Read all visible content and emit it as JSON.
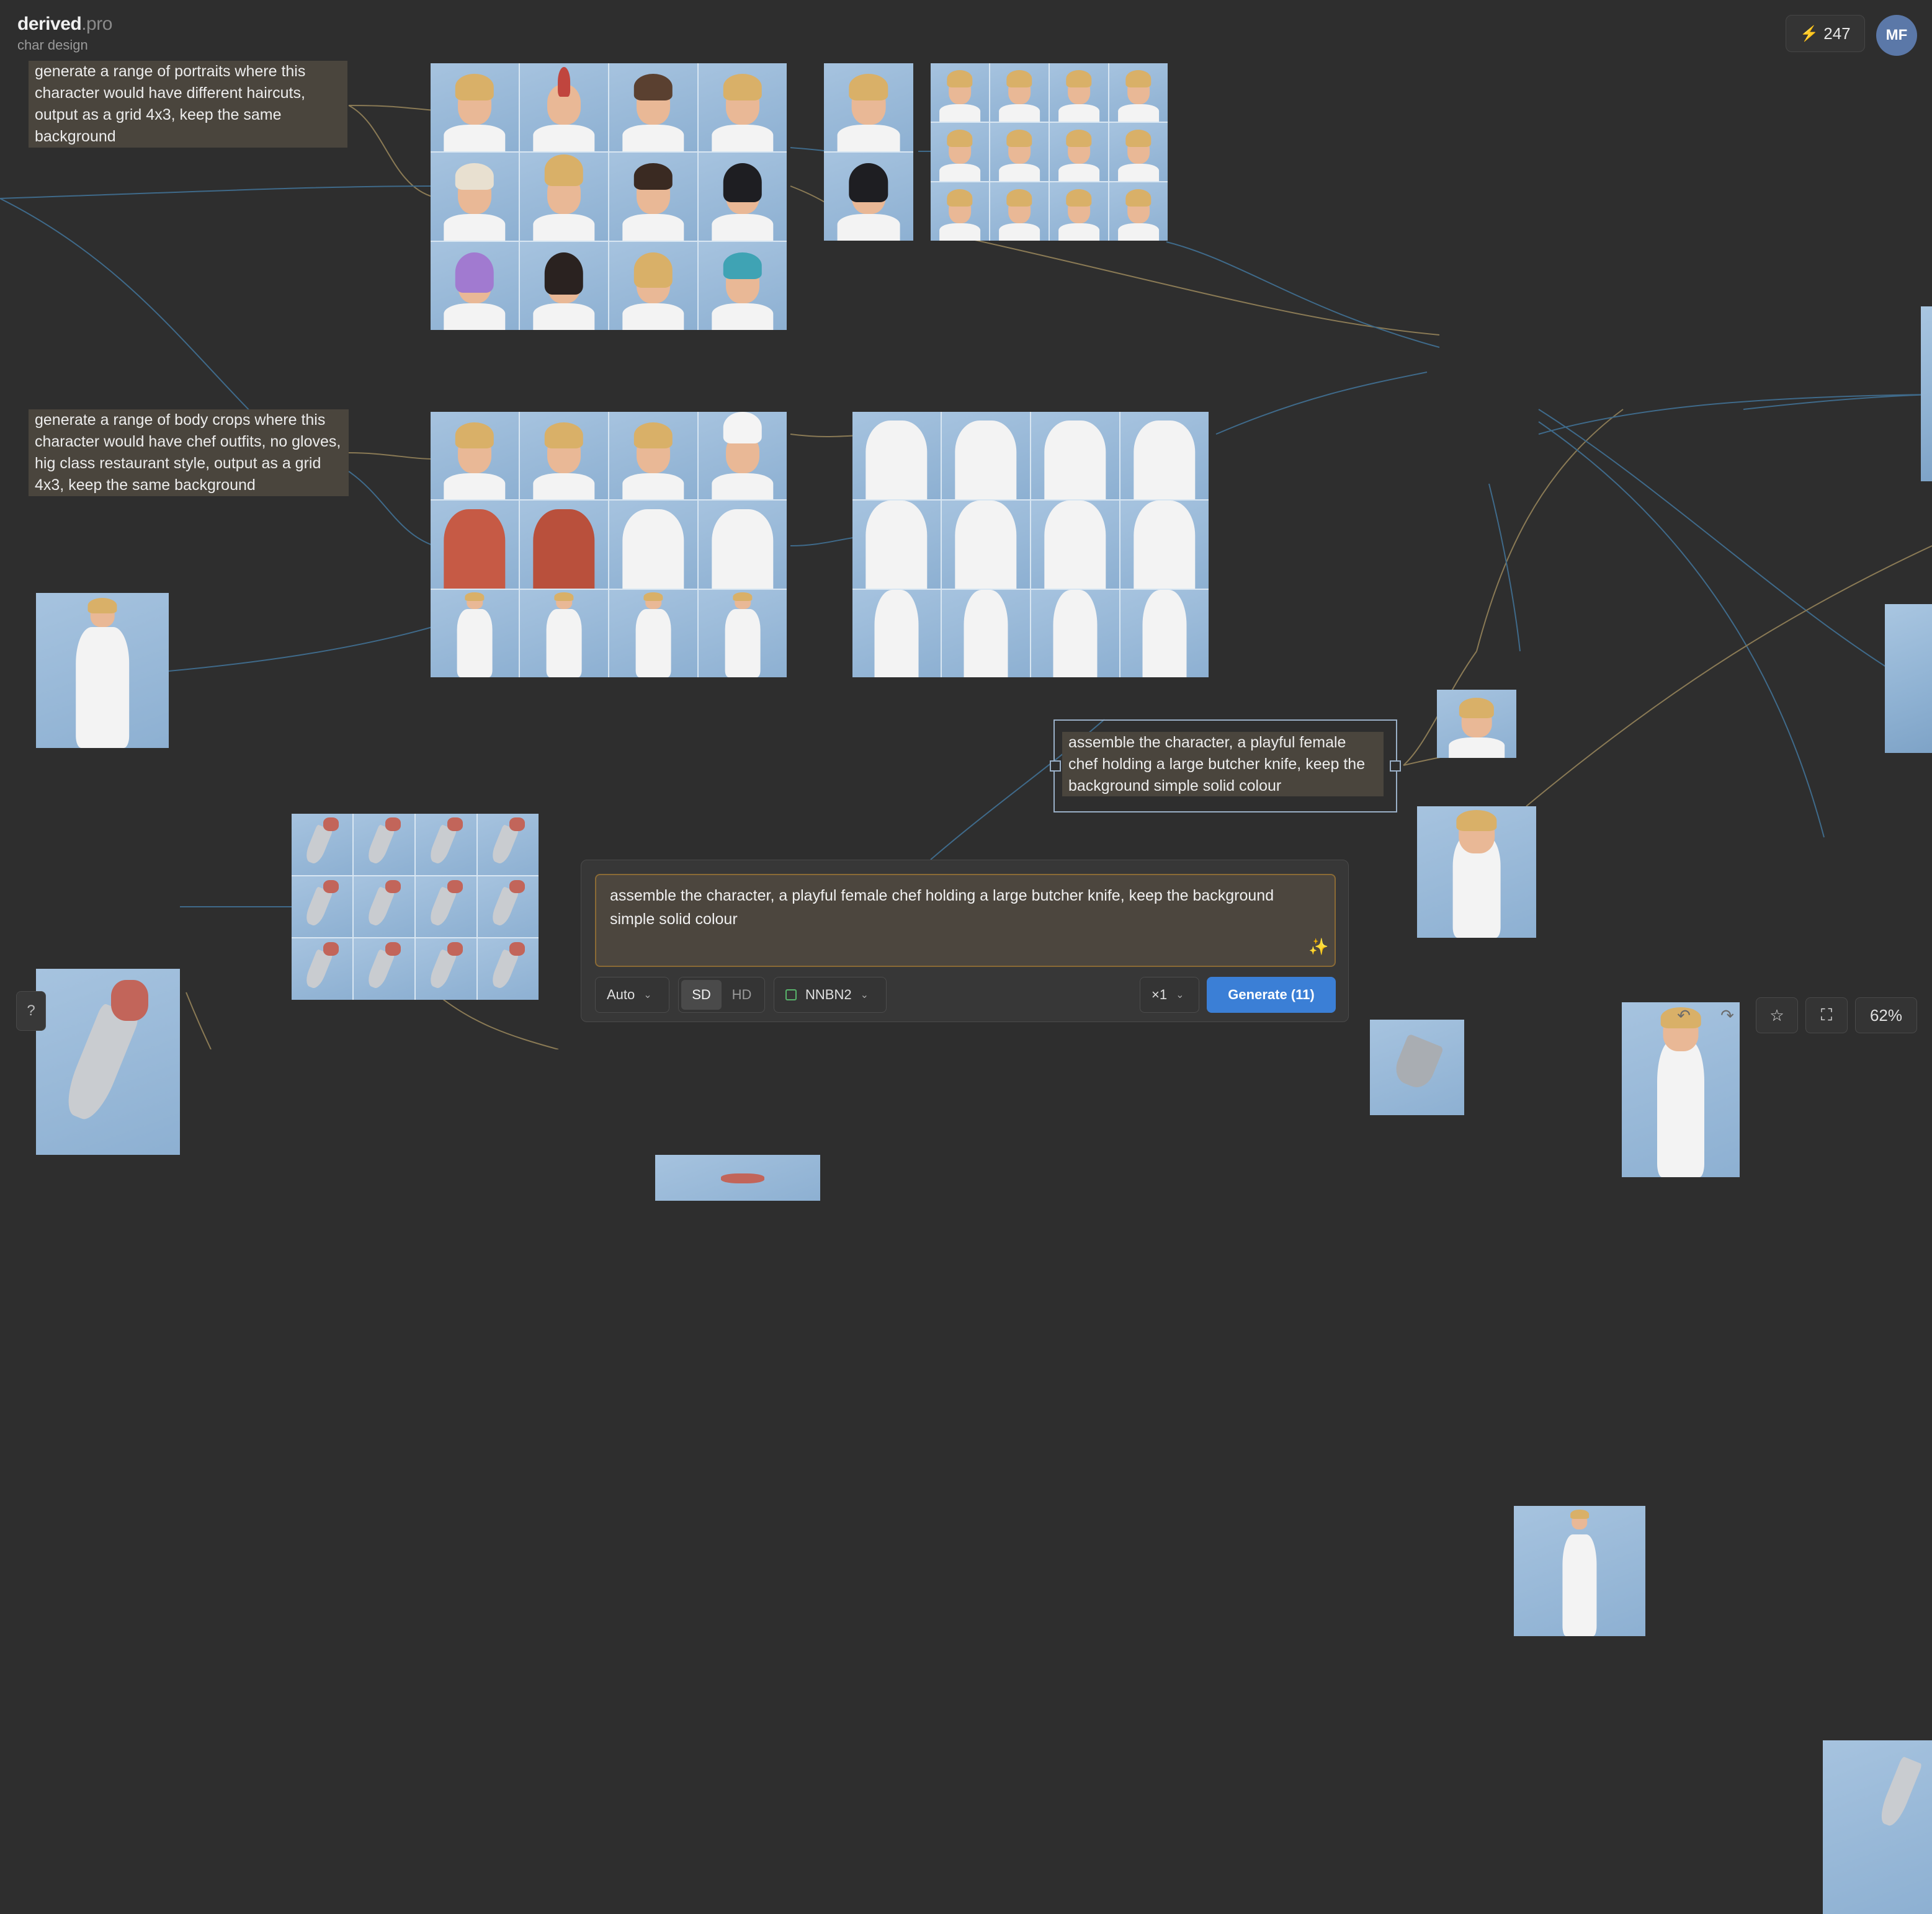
{
  "app": {
    "name": "derived",
    "tld": ".pro",
    "project": "char design"
  },
  "credits": {
    "icon": "lightning-icon",
    "count": "247"
  },
  "user": {
    "initials": "MF"
  },
  "notes": {
    "haircuts": "generate a range of portraits where this character would have different haircuts, output as a grid 4x3, keep the same background",
    "outfits": "generate a range of body crops where this character would have chef outfits, no gloves, hig class restaurant style, output as a grid 4x3, keep the same background",
    "assemble": "assemble the character, a playful female chef holding a large butcher knife, keep the background simple solid colour"
  },
  "composer": {
    "prompt": "assemble the character, a playful female chef holding a large butcher knife, keep the background simple solid colour",
    "aspect": "Auto",
    "quality_options": [
      "SD",
      "HD"
    ],
    "quality_selected": "SD",
    "model": "NNBN2",
    "count": "×1",
    "generate_label": "Generate (11)"
  },
  "help_label": "?",
  "zoom_label": "62%",
  "colors": {
    "accent": "#3b7fd6",
    "note_bg": "#4a453d",
    "canvas": "#2e2e2e"
  }
}
